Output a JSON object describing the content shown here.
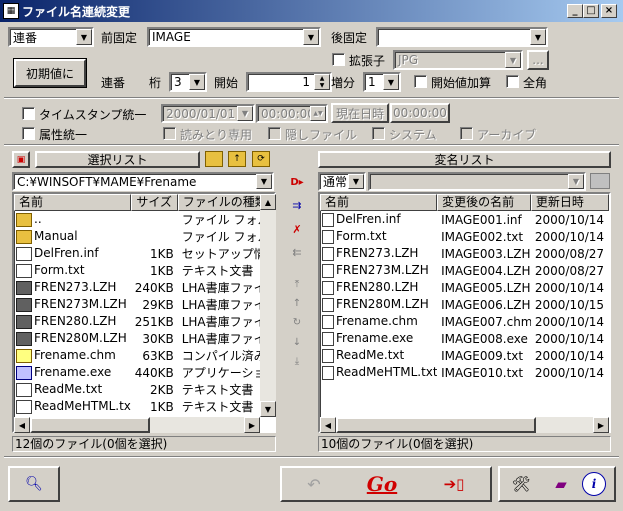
{
  "window": {
    "title": "ファイル名連続変更",
    "min": "_",
    "max": "□",
    "close": "×"
  },
  "top": {
    "mode": "連番",
    "prefix_label": "前固定",
    "prefix_value": "IMAGE",
    "suffix_label": "後固定",
    "suffix_value": "",
    "ext_label": "拡張子",
    "ext_value": "JPG",
    "ext_btn": "...",
    "init_btn": "初期値に",
    "seq_label": "連番",
    "digits_label": "桁",
    "digits_value": "3",
    "start_label": "開始",
    "start_value": "1",
    "step_label": "増分",
    "step_value": "1",
    "startadd_label": "開始値加算",
    "fullwidth_label": "全角"
  },
  "opts": {
    "timestamp_label": "タイムスタンプ統一",
    "date": "2000/01/01",
    "time": "00:00:00",
    "now_btn": "現在日時",
    "time_btn": "00:00:00",
    "attr_label": "属性統一",
    "readonly": "読みとり専用",
    "hidden": "隠しファイル",
    "system": "システム",
    "archive": "アーカイブ"
  },
  "left": {
    "title": "選択リスト",
    "path": "C:¥WINSOFT¥MAME¥Frename",
    "headers": [
      "名前",
      "サイズ",
      "ファイルの種類"
    ],
    "rows": [
      {
        "icon": "folder",
        "name": "..",
        "size": "",
        "type": "ファイル フォルダ"
      },
      {
        "icon": "folder",
        "name": "Manual",
        "size": "",
        "type": "ファイル フォルダ"
      },
      {
        "icon": "inf",
        "name": "DelFren.inf",
        "size": "1KB",
        "type": "セットアップ情報"
      },
      {
        "icon": "txt",
        "name": "Form.txt",
        "size": "1KB",
        "type": "テキスト文書"
      },
      {
        "icon": "lzh",
        "name": "FREN273.LZH",
        "size": "240KB",
        "type": "LHA書庫ファイル"
      },
      {
        "icon": "lzh",
        "name": "FREN273M.LZH",
        "size": "29KB",
        "type": "LHA書庫ファイル"
      },
      {
        "icon": "lzh",
        "name": "FREN280.LZH",
        "size": "251KB",
        "type": "LHA書庫ファイル"
      },
      {
        "icon": "lzh",
        "name": "FREN280M.LZH",
        "size": "30KB",
        "type": "LHA書庫ファイル"
      },
      {
        "icon": "chm",
        "name": "Frename.chm",
        "size": "63KB",
        "type": "コンパイル済み"
      },
      {
        "icon": "exe",
        "name": "Frename.exe",
        "size": "440KB",
        "type": "アプリケーション"
      },
      {
        "icon": "txt",
        "name": "ReadMe.txt",
        "size": "2KB",
        "type": "テキスト文書"
      },
      {
        "icon": "txt",
        "name": "ReadMeHTML.txt",
        "size": "1KB",
        "type": "テキスト文書"
      }
    ],
    "status": "12個のファイル(0個を選択)"
  },
  "right": {
    "title": "変名リスト",
    "view": "通常",
    "filter": "",
    "headers": [
      "名前",
      "変更後の名前",
      "更新日時"
    ],
    "rows": [
      {
        "name": "DelFren.inf",
        "new": "IMAGE001.inf",
        "date": "2000/10/14"
      },
      {
        "name": "Form.txt",
        "new": "IMAGE002.txt",
        "date": "2000/10/14"
      },
      {
        "name": "FREN273.LZH",
        "new": "IMAGE003.LZH",
        "date": "2000/08/27"
      },
      {
        "name": "FREN273M.LZH",
        "new": "IMAGE004.LZH",
        "date": "2000/08/27"
      },
      {
        "name": "FREN280.LZH",
        "new": "IMAGE005.LZH",
        "date": "2000/10/14"
      },
      {
        "name": "FREN280M.LZH",
        "new": "IMAGE006.LZH",
        "date": "2000/10/15"
      },
      {
        "name": "Frename.chm",
        "new": "IMAGE007.chm",
        "date": "2000/10/14"
      },
      {
        "name": "Frename.exe",
        "new": "IMAGE008.exe",
        "date": "2000/10/14"
      },
      {
        "name": "ReadMe.txt",
        "new": "IMAGE009.txt",
        "date": "2000/10/14"
      },
      {
        "name": "ReadMeHTML.txt",
        "new": "IMAGE010.txt",
        "date": "2000/10/14"
      }
    ],
    "status": "10個のファイル(0個を選択)"
  },
  "bottom": {
    "go": "Go"
  }
}
